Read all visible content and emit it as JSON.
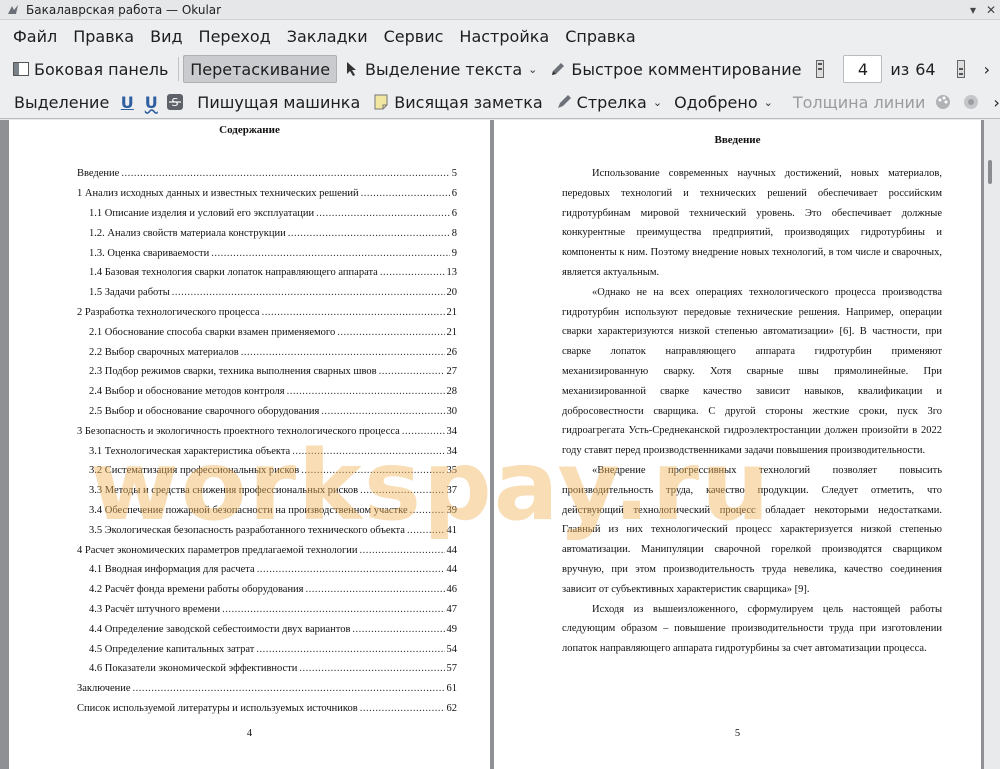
{
  "window": {
    "title": "Бакалаврская работа  — Okular"
  },
  "menubar": {
    "items": [
      "Файл",
      "Правка",
      "Вид",
      "Переход",
      "Закладки",
      "Сервис",
      "Настройка",
      "Справка"
    ]
  },
  "toolbar1": {
    "sidebar_label": "Боковая панель",
    "drag_label": "Перетаскивание",
    "text_select_label": "Выделение текста",
    "quick_comment_label": "Быстрое комментирование",
    "page_current": "4",
    "page_of": "из",
    "page_total": "64"
  },
  "toolbar2": {
    "highlight_label": "Выделение",
    "typewriter_label": "Пишущая машинка",
    "sticky_note_label": "Висящая заметка",
    "arrow_label": "Стрелка",
    "stamp_label": "Одобрено",
    "line_width_label": "Толщина линии"
  },
  "left_page": {
    "title": "Содержание",
    "page_number": "4",
    "toc": [
      {
        "t": "Введение",
        "p": "5",
        "sub": false
      },
      {
        "t": "1 Анализ исходных данных и известных технических решений",
        "p": "6",
        "sub": false
      },
      {
        "t": "1.1 Описание изделия и условий его эксплуатации",
        "p": "6",
        "sub": true
      },
      {
        "t": "1.2. Анализ свойств материала конструкции",
        "p": "8",
        "sub": true
      },
      {
        "t": "1.3. Оценка свариваемости",
        "p": "9",
        "sub": true
      },
      {
        "t": "1.4 Базовая технология сварки лопаток направляющего аппарата",
        "p": "13",
        "sub": true
      },
      {
        "t": "1.5 Задачи работы",
        "p": "20",
        "sub": true
      },
      {
        "t": "2 Разработка технологического процесса",
        "p": "21",
        "sub": false
      },
      {
        "t": "2.1 Обоснование способа сварки взамен применяемого",
        "p": "21",
        "sub": true
      },
      {
        "t": "2.2 Выбор сварочных материалов",
        "p": "26",
        "sub": true
      },
      {
        "t": "2.3 Подбор режимов сварки, техника выполнения сварных швов",
        "p": "27",
        "sub": true
      },
      {
        "t": "2.4 Выбор и обоснование методов контроля",
        "p": "28",
        "sub": true
      },
      {
        "t": "2.5 Выбор и обоснование сварочного оборудования",
        "p": "30",
        "sub": true
      },
      {
        "t": "3 Безопасность и экологичность проектного технологического процесса",
        "p": "34",
        "sub": false
      },
      {
        "t": "3.1 Технологическая характеристика объекта",
        "p": "34",
        "sub": true
      },
      {
        "t": "3.2 Систематизация профессиональных рисков",
        "p": "35",
        "sub": true
      },
      {
        "t": "3.3 Методы и средства снижения профессиональных рисков",
        "p": "37",
        "sub": true
      },
      {
        "t": "3.4 Обеспечение пожарной безопасности на производственном участке",
        "p": "39",
        "sub": true
      },
      {
        "t": "3.5 Экологическая безопасность разработанного технического объекта",
        "p": "41",
        "sub": true
      },
      {
        "t": "4 Расчет экономических параметров предлагаемой технологии",
        "p": "44",
        "sub": false
      },
      {
        "t": "4.1 Вводная информация для расчета",
        "p": "44",
        "sub": true
      },
      {
        "t": "4.2 Расчёт фонда времени работы оборудования",
        "p": "46",
        "sub": true
      },
      {
        "t": "4.3 Расчёт штучного времени",
        "p": "47",
        "sub": true
      },
      {
        "t": "4.4 Определение заводской себестоимости двух  вариантов",
        "p": "49",
        "sub": true
      },
      {
        "t": "4.5 Определение капитальных затрат",
        "p": "54",
        "sub": true
      },
      {
        "t": "4.6 Показатели экономической эффективности",
        "p": "57",
        "sub": true
      },
      {
        "t": "Заключение",
        "p": "61",
        "sub": false
      },
      {
        "t": "Список используемой литературы и используемых источников",
        "p": "62",
        "sub": false
      }
    ]
  },
  "right_page": {
    "title": "Введение",
    "page_number": "5",
    "paragraphs": [
      "Использование современных научных достижений, новых материалов, передовых технологий и технических решений обеспечивает российским гидротурбинам мировой технический уровень. Это обеспечивает должные конкурентные преимущества предприятий, производящих гидротурбины и компоненты к ним. Поэтому внедрение новых технологий, в том числе и сварочных, является актуальным.",
      "«Однако не на всех операциях технологического процесса производства гидротурбин используют передовые технические решения. Например, операции сварки характеризуются низкой степенью автоматизации» [6]. В частности, при сварке лопаток направляющего аппарата гидротурбин применяют механизированную сварку. Хотя сварные швы прямолинейные. При механизированной сварке качество зависит навыков, квалификации и добросовестности сварщика. С другой стороны жесткие сроки, пуск 3го гидроагрегата Усть-Среднеканской гидроэлектростанции должен произойти в 2022 году ставят перед производственниками задачи повышения производительности.",
      "«Внедрение прогрессивных технологий позволяет повысить производительность труда, качество продукции. Следует отметить, что действующий технологический процесс обладает некоторыми недостатками. Главный из них  технологический процесс характеризуется низкой степенью автоматизации. Манипуляции сварочной горелкой производятся сварщиком вручную, при этом производительность труда невелика, качество соединения зависит от субъективных характеристик сварщика» [9].",
      "Исходя из вышеизложенного, сформулируем цель настоящей работы следующим образом – повышение производительности труда при изготовлении лопаток направляющего аппарата гидротурбины за счет автоматизации процесса."
    ]
  },
  "watermark": {
    "text": "workspay.ru"
  }
}
